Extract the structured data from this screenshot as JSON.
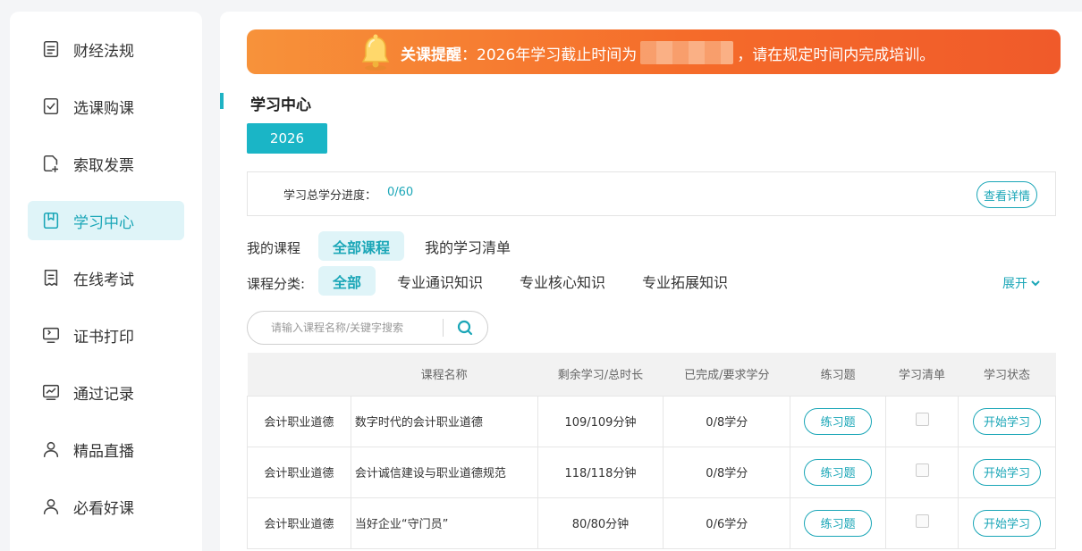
{
  "sidebar": {
    "items": [
      {
        "label": "财经法规",
        "icon": "document-icon"
      },
      {
        "label": "选课购课",
        "icon": "checklist-icon"
      },
      {
        "label": "索取发票",
        "icon": "invoice-add-icon"
      },
      {
        "label": "学习中心",
        "icon": "bookmark-book-icon",
        "active": true
      },
      {
        "label": "在线考试",
        "icon": "exam-paper-icon"
      },
      {
        "label": "证书打印",
        "icon": "monitor-icon"
      },
      {
        "label": "通过记录",
        "icon": "chart-icon"
      },
      {
        "label": "精品直播",
        "icon": "user-icon"
      },
      {
        "label": "必看好课",
        "icon": "user-icon"
      }
    ]
  },
  "banner": {
    "title": "关课提醒",
    "colon": "：",
    "text_before": "2026年学习截止时间为",
    "text_after": "，请在规定时间内完成培训。"
  },
  "section": {
    "title": "学习中心"
  },
  "year_tab": "2026",
  "progress": {
    "label": "学习总学分进度：",
    "value": "0/60",
    "detail_label": "查看详情"
  },
  "my_courses": {
    "label": "我的课程",
    "tabs": [
      "全部课程",
      "我的学习清单"
    ]
  },
  "category": {
    "label": "课程分类:",
    "tabs": [
      "全部",
      "专业通识知识",
      "专业核心知识",
      "专业拓展知识"
    ],
    "expand_label": "展开"
  },
  "search": {
    "placeholder": "请输入课程名称/关键字搜索"
  },
  "table": {
    "headers": [
      "",
      "课程名称",
      "剩余学习/总时长",
      "已完成/要求学分",
      "练习题",
      "学习清单",
      "学习状态"
    ],
    "rows": [
      {
        "category": "会计职业道德",
        "name": "数字时代的会计职业道德",
        "time": "109/109分钟",
        "credit": "0/8学分",
        "exercise": "练习题",
        "action": "开始学习"
      },
      {
        "category": "会计职业道德",
        "name": "会计诚信建设与职业道德规范",
        "time": "118/118分钟",
        "credit": "0/8学分",
        "exercise": "练习题",
        "action": "开始学习"
      },
      {
        "category": "会计职业道德",
        "name": "当好企业“守门员”",
        "time": "80/80分钟",
        "credit": "0/6学分",
        "exercise": "练习题",
        "action": "开始学习"
      }
    ]
  },
  "colors": {
    "accent": "#1aa6b7",
    "banner_start": "#f7923a",
    "banner_end": "#f05a2a"
  }
}
